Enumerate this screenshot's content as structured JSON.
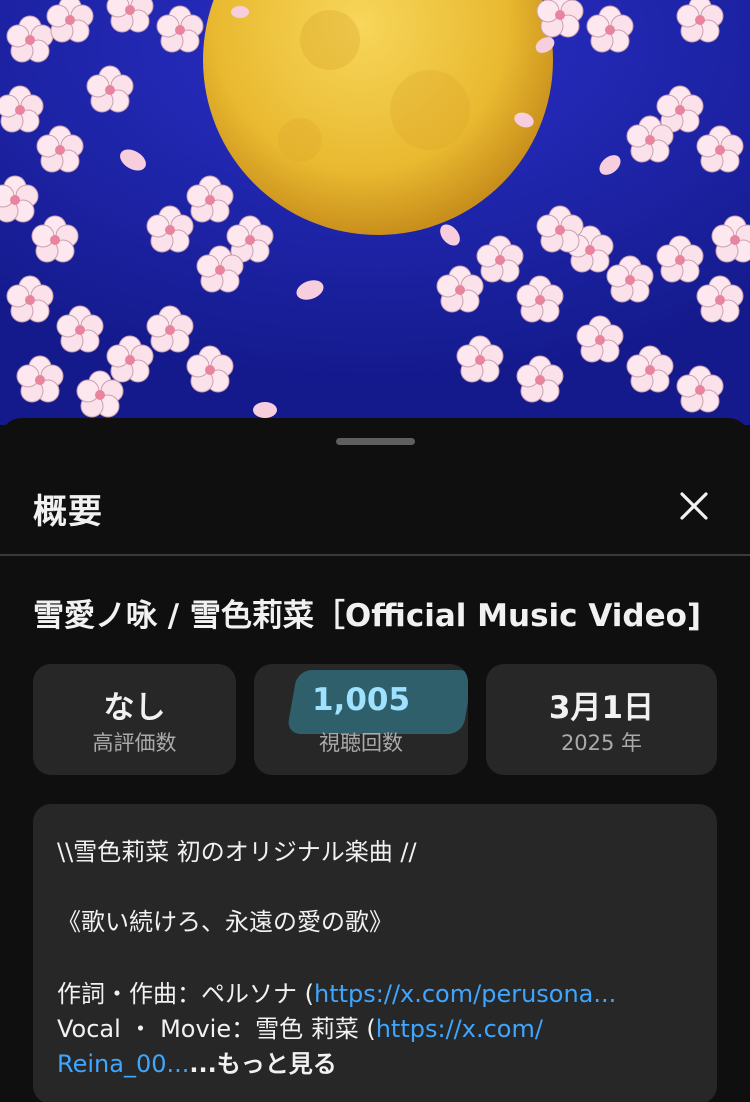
{
  "sheet": {
    "title": "概要",
    "close_icon": "close-icon"
  },
  "video": {
    "title": "雪愛ノ咏 / 雪色莉菜［Official Music Video]"
  },
  "stats": {
    "likes": {
      "value": "なし",
      "label": "高評価数"
    },
    "views": {
      "value": "1,005",
      "label": "視聴回数"
    },
    "date": {
      "value": "3月1日",
      "label": "2025 年"
    }
  },
  "description": {
    "line1": "\\\\雪色莉菜 初のオリジナル楽曲 //",
    "line2": "《歌い続けろ、永遠の愛の歌》",
    "line3_prefix": "作詞・作曲：ペルソナ (",
    "line3_link": "https://x.com/perusona...",
    "line4_prefix": "Vocal ・ Movie：雪色 莉菜 (",
    "line4_link": "https://x.com/",
    "line5_link": "Reina_00...",
    "line5_more": "...もっと見る"
  },
  "colors": {
    "background": "#0f0f0f",
    "card": "#272727",
    "link": "#3ea6ff",
    "sky": "#1b1fa6",
    "moon": "#f2c437"
  }
}
